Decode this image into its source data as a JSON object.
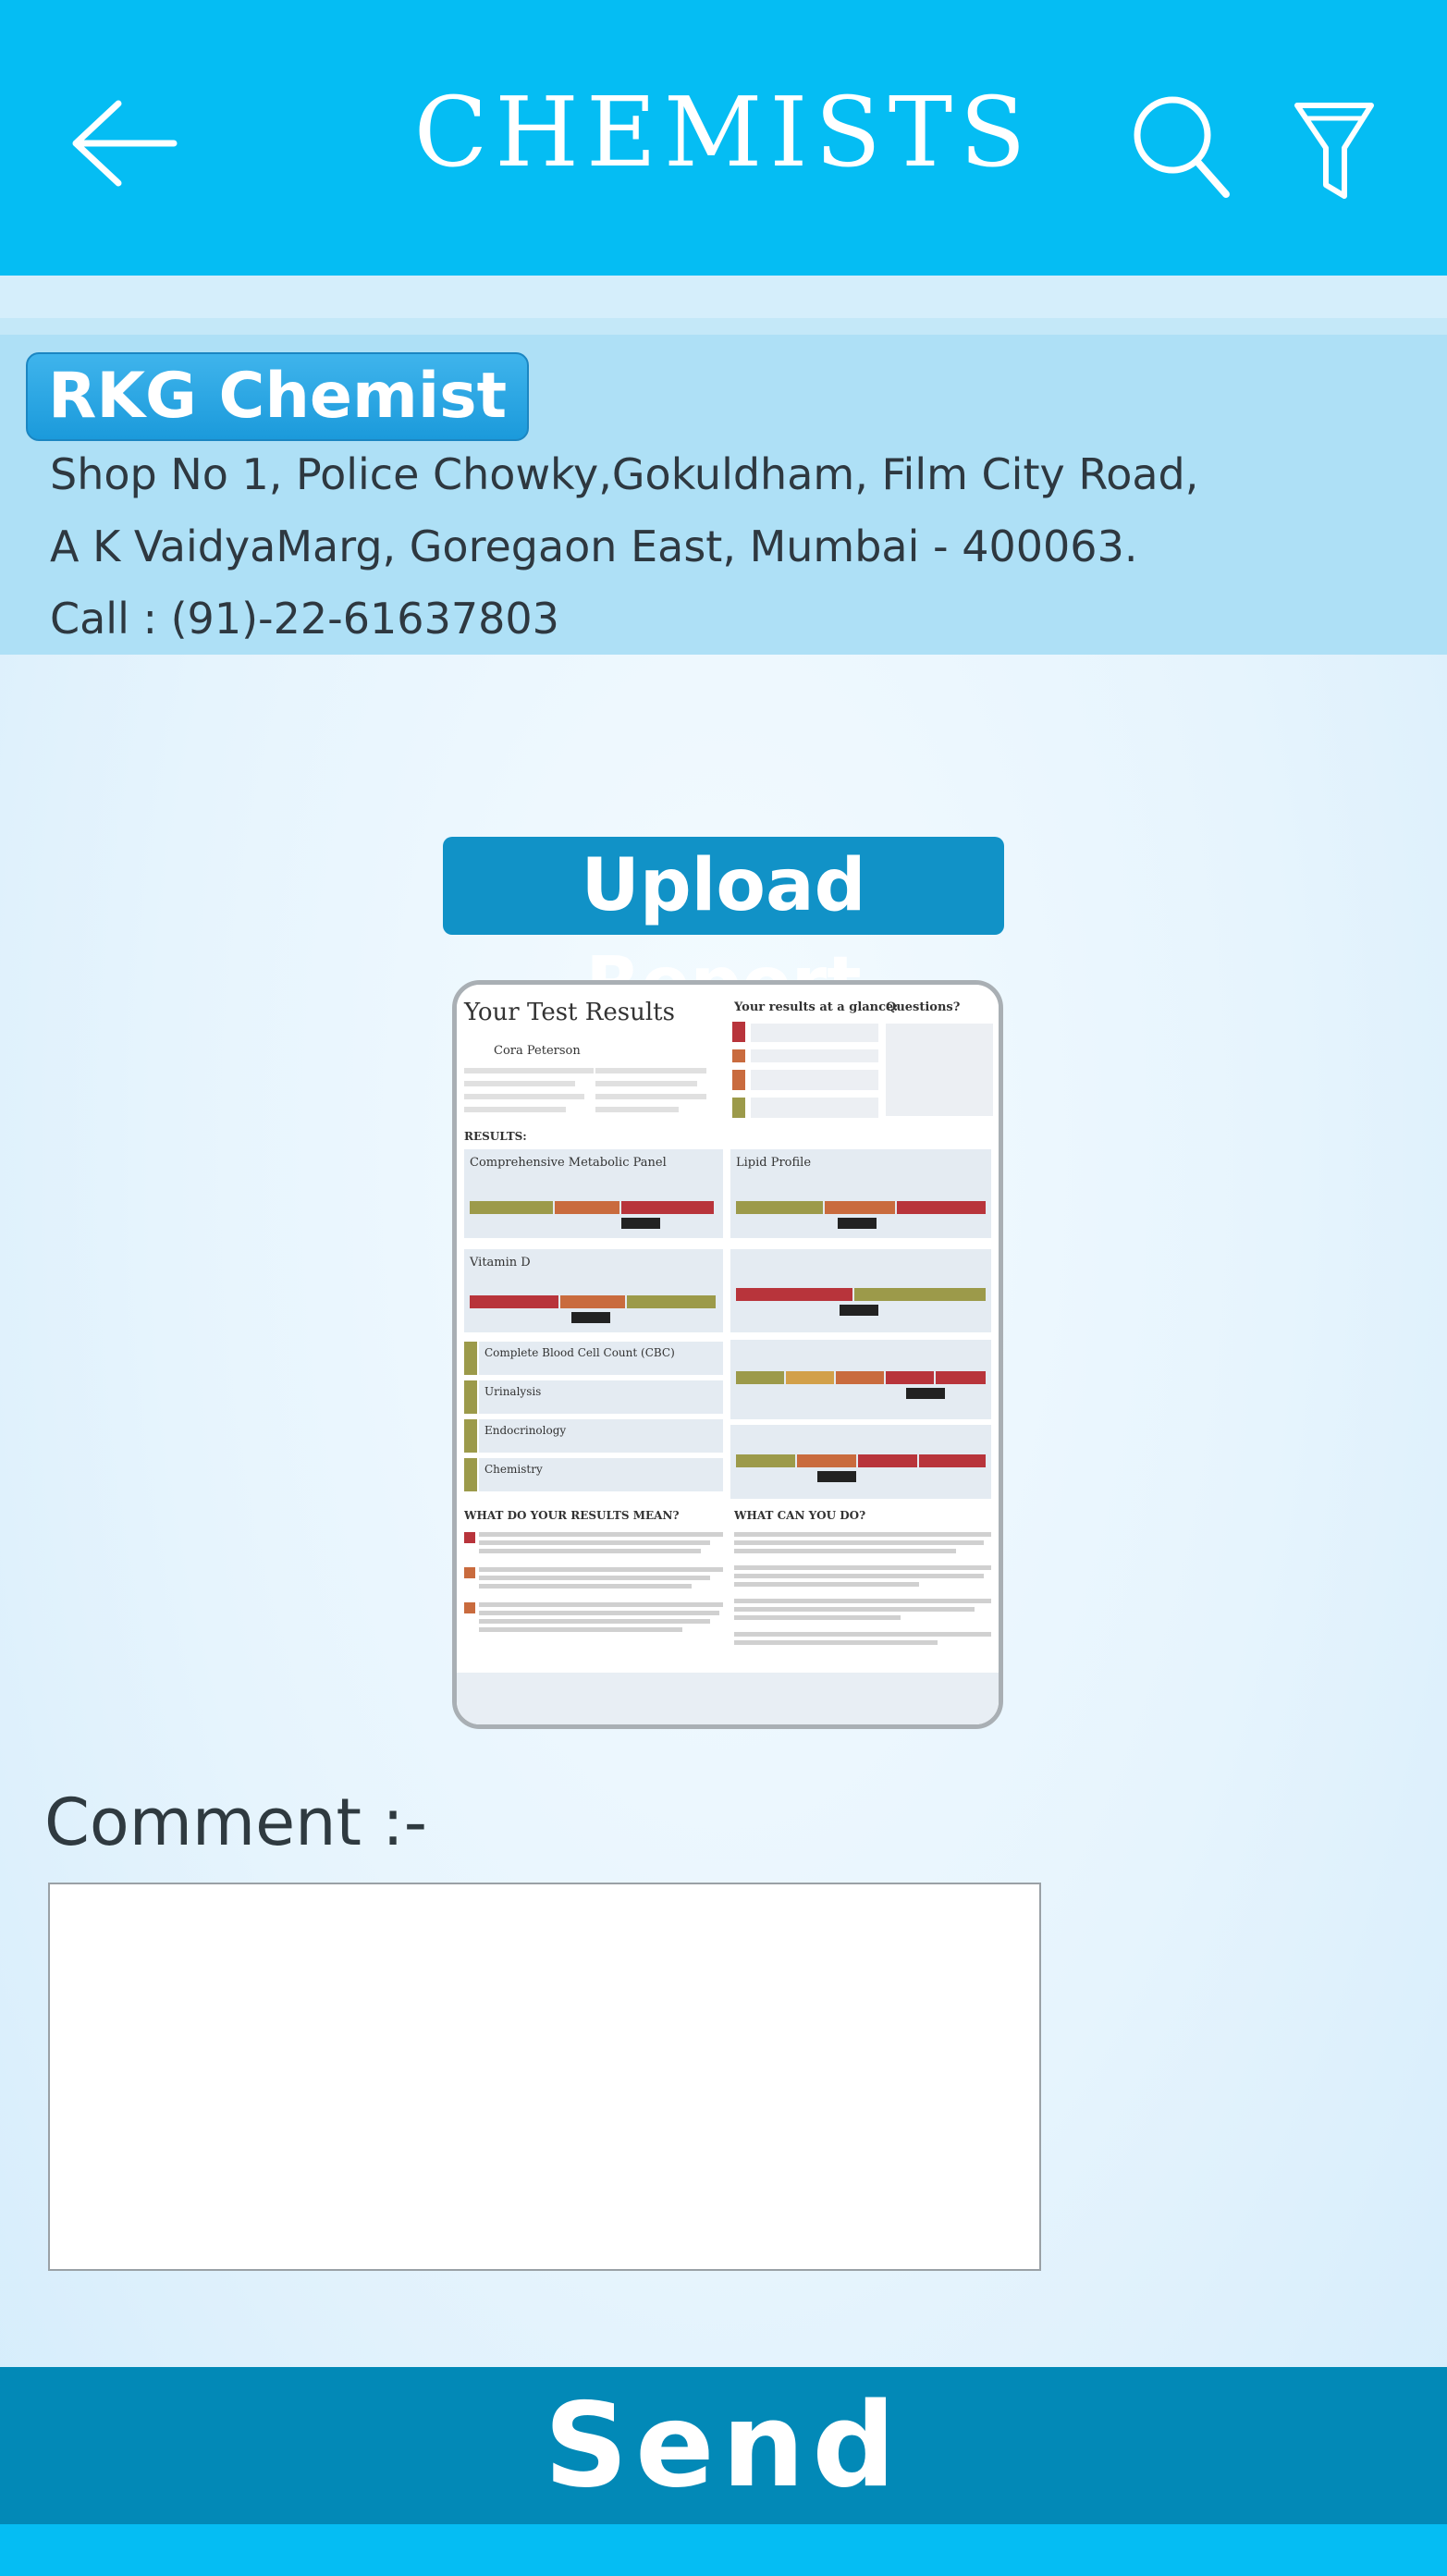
{
  "header": {
    "title": "CHEMISTS",
    "back_icon": "arrow-left-icon",
    "search_icon": "search-icon",
    "filter_icon": "filter-icon"
  },
  "chemist": {
    "name": "RKG Chemist",
    "address_line1": "Shop No 1, Police Chowky,Gokuldham, Film City Road,",
    "address_line2": "A K VaidyaMarg, Goregaon East, Mumbai - 400063.",
    "phone": "Call : (91)-22-61637803"
  },
  "upload": {
    "label": "Upload Report"
  },
  "report_preview": {
    "heading": "Your Test Results",
    "glance_heading": "Your results at a glance:",
    "questions_heading": "Questions?",
    "patient": "Cora Peterson",
    "results_label": "RESULTS:",
    "panel_1": "Comprehensive Metabolic Panel",
    "panel_2": "Lipid Profile",
    "panel_3": "Vitamin D",
    "panel_4": "Complete Blood Cell Count (CBC)",
    "panel_5": "Urinalysis",
    "panel_6": "Endocrinology",
    "panel_7": "Chemistry",
    "meaning_heading": "WHAT DO YOUR RESULTS MEAN?",
    "action_heading": "WHAT CAN YOU DO?"
  },
  "comment": {
    "label": "Comment :-",
    "value": "",
    "placeholder": ""
  },
  "send": {
    "label": "Send"
  },
  "colors": {
    "header_bg": "#05bdf3",
    "card_bg": "#aee0f6",
    "badge_bg": "#1b9adb",
    "upload_bg": "#1192c7",
    "send_bg": "#0289b7"
  }
}
